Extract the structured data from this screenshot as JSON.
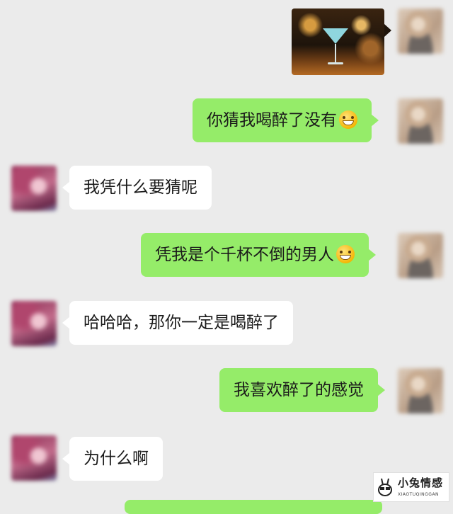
{
  "chat": {
    "messages": [
      {
        "sender": "me",
        "type": "image",
        "image_desc": "cocktail-glass-photo"
      },
      {
        "sender": "me",
        "type": "text",
        "text": "你猜我喝醉了没有",
        "emoji": "grin-emoji"
      },
      {
        "sender": "them",
        "type": "text",
        "text": "我凭什么要猜呢"
      },
      {
        "sender": "me",
        "type": "text",
        "text": "凭我是个千杯不倒的男人",
        "emoji": "grimace-emoji"
      },
      {
        "sender": "them",
        "type": "text",
        "text": "哈哈哈，那你一定是喝醉了"
      },
      {
        "sender": "me",
        "type": "text",
        "text": "我喜欢醉了的感觉"
      },
      {
        "sender": "them",
        "type": "text",
        "text": "为什么啊"
      }
    ]
  },
  "watermark": {
    "title": "小兔情感",
    "subtitle": "XIAOTUQINGGAN"
  },
  "colors": {
    "background": "#ebebeb",
    "my_bubble": "#95ec69",
    "their_bubble": "#ffffff"
  }
}
